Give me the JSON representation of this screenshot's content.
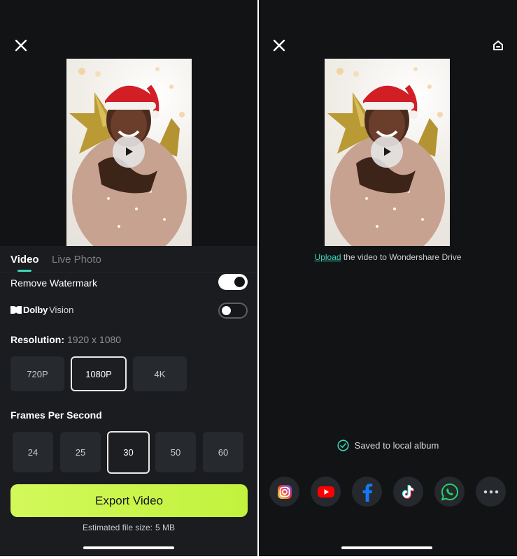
{
  "left_screen": {
    "tabs": [
      {
        "label": "Video",
        "active": true
      },
      {
        "label": "Live Photo",
        "active": false
      }
    ],
    "remove_watermark": {
      "label": "Remove Watermark",
      "enabled": true
    },
    "dolby_vision": {
      "brand": "Dolby",
      "product": "Vision",
      "enabled": false
    },
    "resolution": {
      "label": "Resolution:",
      "value": "1920 x 1080",
      "options": [
        "720P",
        "1080P",
        "4K"
      ],
      "selected": "1080P"
    },
    "fps": {
      "label": "Frames Per Second",
      "options": [
        "24",
        "25",
        "30",
        "50",
        "60"
      ],
      "selected": "30"
    },
    "export_button": "Export Video",
    "estimated_size": {
      "label": "Estimated file size:",
      "value": "5 MB"
    }
  },
  "right_screen": {
    "upload": {
      "link_text": "Upload",
      "rest": " the video to Wondershare Drive"
    },
    "saved_status": "Saved to local album",
    "share_targets": [
      "instagram",
      "youtube",
      "facebook",
      "tiktok",
      "whatsapp",
      "more"
    ]
  },
  "icons": {
    "close": "close-icon",
    "home": "home-icon",
    "play": "play-icon",
    "check": "check-circle-icon"
  },
  "colors": {
    "background": "#111315",
    "panel": "#1a1c1f",
    "accent_teal": "#3bd4b6",
    "export_green": "#c8f54a",
    "youtube_red": "#ff0000",
    "facebook_blue": "#1877f2",
    "whatsapp_green": "#25d366"
  }
}
